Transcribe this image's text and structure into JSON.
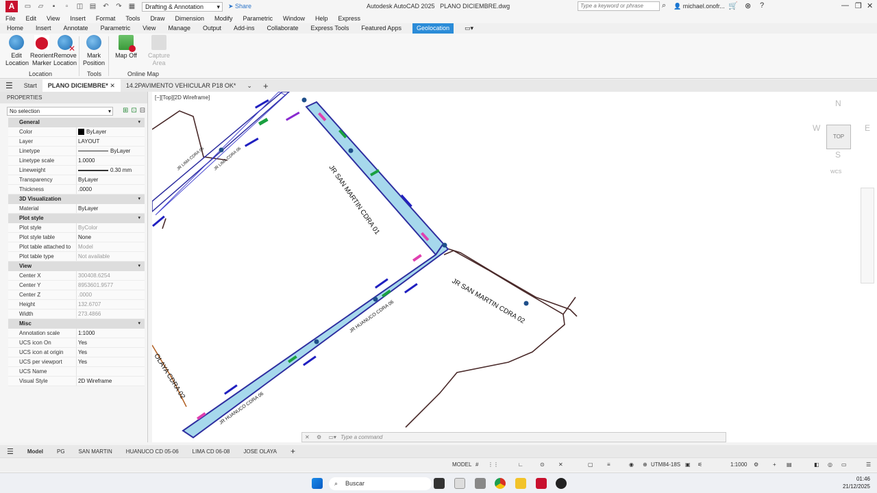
{
  "app": {
    "title": "Autodesk AutoCAD 2025",
    "file": "PLANO DICIEMBRE.dwg",
    "logo": "A",
    "workspace": "Drafting & Annotation",
    "share": "Share",
    "search_placeholder": "Type a keyword or phrase",
    "user": "michael.onofr..."
  },
  "menu": [
    "File",
    "Edit",
    "View",
    "Insert",
    "Format",
    "Tools",
    "Draw",
    "Dimension",
    "Modify",
    "Parametric",
    "Window",
    "Help",
    "Express"
  ],
  "ribbon_tabs": [
    "Home",
    "Insert",
    "Annotate",
    "Parametric",
    "View",
    "Manage",
    "Output",
    "Add-ins",
    "Collaborate",
    "Express Tools",
    "Featured Apps",
    "Geolocation"
  ],
  "ribbon_active": "Geolocation",
  "ribbon": {
    "location": {
      "label": "Location",
      "buttons": [
        {
          "l1": "Edit",
          "l2": "Location"
        },
        {
          "l1": "Reorient",
          "l2": "Marker"
        },
        {
          "l1": "Remove",
          "l2": "Location"
        }
      ]
    },
    "tools": {
      "label": "Tools",
      "mark_l1": "Mark",
      "mark_l2": "Position"
    },
    "online_map": {
      "label": "Online Map",
      "map_off": "Map Off",
      "capture_l1": "Capture",
      "capture_l2": "Area"
    }
  },
  "doc_tabs": [
    "Start",
    "PLANO DICIEMBRE*",
    "14.2PAVIMENTO VEHICULAR P18 OK*"
  ],
  "properties": {
    "title": "PROPERTIES",
    "selection": "No selection",
    "sections": [
      {
        "name": "General",
        "rows": [
          {
            "k": "Color",
            "v": "ByLayer",
            "swatch": "#000000"
          },
          {
            "k": "Layer",
            "v": "LAYOUT"
          },
          {
            "k": "Linetype",
            "v": "ByLayer",
            "line": "thin"
          },
          {
            "k": "Linetype scale",
            "v": "1.0000"
          },
          {
            "k": "Lineweight",
            "v": "0.30 mm",
            "line": "thick"
          },
          {
            "k": "Transparency",
            "v": "ByLayer"
          },
          {
            "k": "Thickness",
            "v": ".0000"
          }
        ]
      },
      {
        "name": "3D Visualization",
        "rows": [
          {
            "k": "Material",
            "v": "ByLayer"
          }
        ]
      },
      {
        "name": "Plot style",
        "rows": [
          {
            "k": "Plot style",
            "v": "ByColor",
            "dim": true
          },
          {
            "k": "Plot style table",
            "v": "None"
          },
          {
            "k": "Plot table attached to",
            "v": "Model",
            "dim": true
          },
          {
            "k": "Plot table type",
            "v": "Not available",
            "dim": true
          }
        ]
      },
      {
        "name": "View",
        "rows": [
          {
            "k": "Center X",
            "v": "300408.6254",
            "dim": true
          },
          {
            "k": "Center Y",
            "v": "8953601.9577",
            "dim": true
          },
          {
            "k": "Center Z",
            "v": ".0000",
            "dim": true
          },
          {
            "k": "Height",
            "v": "132.6707",
            "dim": true
          },
          {
            "k": "Width",
            "v": "273.4866",
            "dim": true
          }
        ]
      },
      {
        "name": "Misc",
        "rows": [
          {
            "k": "Annotation scale",
            "v": "1:1000"
          },
          {
            "k": "UCS icon On",
            "v": "Yes"
          },
          {
            "k": "UCS icon at origin",
            "v": "Yes"
          },
          {
            "k": "UCS per viewport",
            "v": "Yes"
          },
          {
            "k": "UCS Name",
            "v": ""
          },
          {
            "k": "Visual Style",
            "v": "2D Wireframe"
          }
        ]
      }
    ]
  },
  "viewport": {
    "label": "[−][Top][2D Wireframe]",
    "streets": [
      "JR SAN MARTIN CDRA 01",
      "JR SAN MARTIN CDRA 02",
      "JR HUANUCO CDRA 06",
      "JR HUANUCO CDRA 06",
      "OLAYA CDRA 02",
      "JR LIMA CDRA 06",
      "JR LIMA CDRA 06"
    ],
    "navcube": {
      "n": "N",
      "s": "S",
      "e": "E",
      "w": "W",
      "top": "TOP",
      "wcs": "WCS"
    },
    "command_placeholder": "Type a command"
  },
  "layout_tabs": [
    "Model",
    "PG",
    "SAN MARTIN",
    "HUANUCO CD 05-06",
    "LIMA CD 06-08",
    "JOSE OLAYA"
  ],
  "status": {
    "mode": "MODEL",
    "coords": "UTM84-18S",
    "scale": "1:1000"
  },
  "taskbar": {
    "search": "Buscar",
    "time": "01:46",
    "date": "21/12/2025"
  },
  "colors": {
    "accent": "#2b8cd8",
    "road_fill": "#a6d8ec",
    "road_line": "#2f2fa0",
    "property_line": "#4a2a2a",
    "dot": "#1f4f8a"
  }
}
